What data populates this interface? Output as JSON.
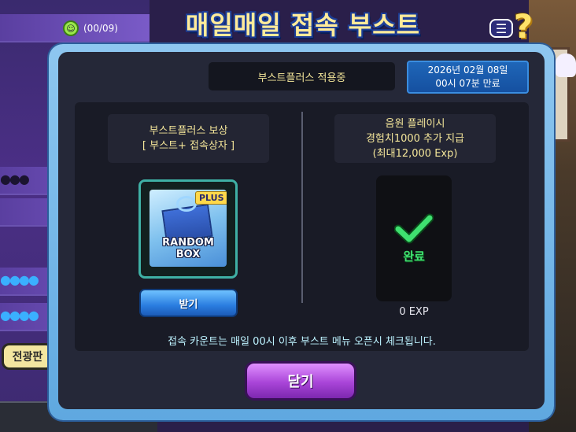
{
  "window": {
    "title": "매일매일 접속 부스트",
    "help_symbol": "?",
    "menu_symbol": "☰"
  },
  "background": {
    "top_counter": "(00/09)",
    "left_button_label": "전광판"
  },
  "dialog": {
    "status": "부스트플러스 적용중",
    "expiry_line1": "2026년 02월 08일",
    "expiry_line2": "00시 07분 만료",
    "left_panel": {
      "title_line1": "부스트플러스 보상",
      "title_line2": "[ 부스트+ 접속상자 ]",
      "item": {
        "badge": "PLUS",
        "name_line1": "RANDOM",
        "name_line2": "BOX",
        "icon": "random-box-icon"
      },
      "receive_button_label": "받기"
    },
    "right_panel": {
      "title_line1": "음원 플레이시",
      "title_line2": "경험치1000 추가 지급",
      "title_line3": "(최대12,000 Exp)",
      "status_icon": "checkmark-icon",
      "status_label": "완료",
      "exp_value": "0 EXP"
    },
    "note": "접속 카운트는 매일 00시 이후 부스트 메뉴 오픈시 체크됩니다.",
    "close_button_label": "닫기"
  },
  "colors": {
    "frame_blue": "#5fa8e0",
    "panel_dark": "#191b26",
    "gold_text": "#f4e69a",
    "check_green": "#3fe070",
    "close_purple": "#a945d8",
    "receive_blue": "#2a7de0"
  }
}
